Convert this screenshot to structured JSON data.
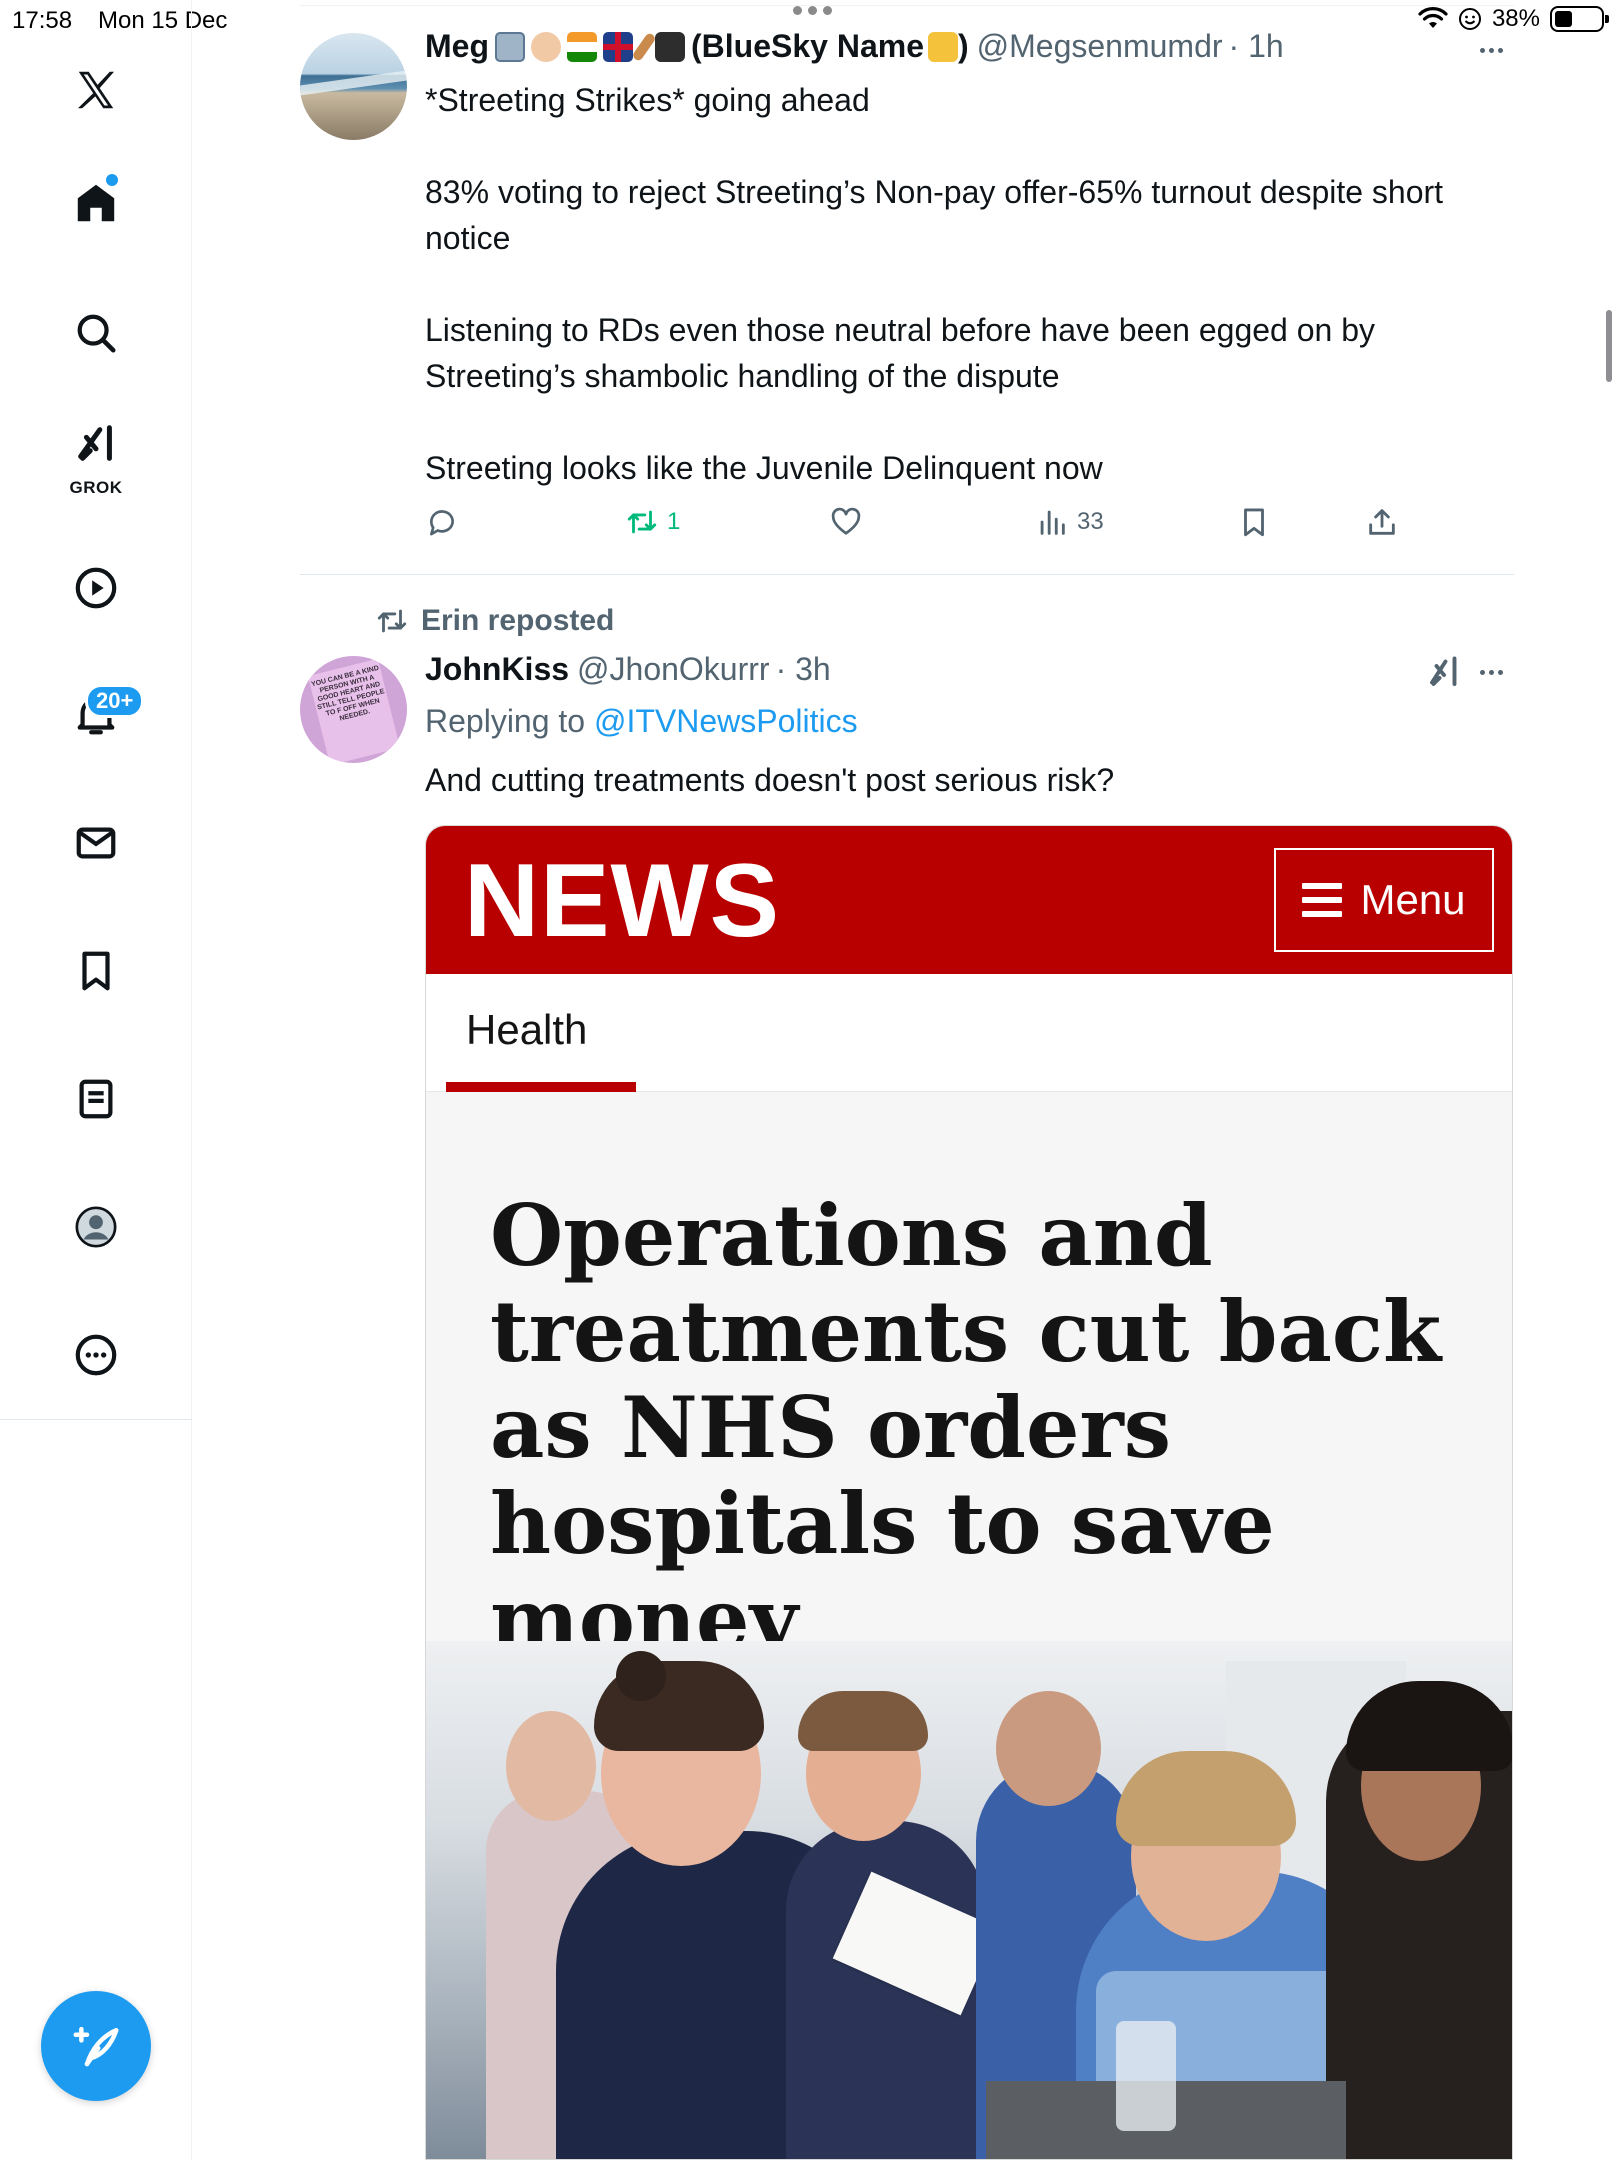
{
  "status_bar": {
    "time": "17:58",
    "date": "Mon 15 Dec",
    "battery": "38%",
    "battery_level": 0.38
  },
  "sidebar": {
    "items": [
      {
        "icon": "x-logo-icon",
        "label": "X"
      },
      {
        "icon": "home-icon",
        "label": "Home"
      },
      {
        "icon": "search-icon",
        "label": "Explore"
      },
      {
        "icon": "grok-icon",
        "label": "GROK"
      },
      {
        "icon": "video-icon",
        "label": "Videos"
      },
      {
        "icon": "bell-icon",
        "label": "Notifications"
      },
      {
        "icon": "mail-icon",
        "label": "Messages"
      },
      {
        "icon": "bookmark-icon",
        "label": "Bookmarks"
      },
      {
        "icon": "article-icon",
        "label": "Articles"
      },
      {
        "icon": "profile-icon",
        "label": "Profile"
      },
      {
        "icon": "more-icon",
        "label": "More"
      }
    ],
    "notification_badge": "20+",
    "grok_label": "GROK",
    "compose_icon": "compose-icon"
  },
  "tweets": [
    {
      "name": "Meg",
      "name_suffix": "(BlueSky Name",
      "name_close": ")",
      "handle": "@Megsenmumdr",
      "time": "· 1h",
      "text": [
        "*Streeting Strikes* going ahead",
        "83% voting to reject Streeting’s Non-pay offer-65% turnout despite short notice",
        "Listening to RDs even those neutral before have been egged on by Streeting’s shambolic handling of the dispute",
        "Streeting looks like the Juvenile Delinquent now"
      ],
      "retweets": "1",
      "views": "33"
    },
    {
      "reposted_by": "Erin reposted",
      "name": "JohnKiss",
      "handle": "@JhonOkurrr",
      "time": "· 3h",
      "replying_prefix": "Replying to",
      "replying_to": "@ITVNewsPolitics",
      "text": "And cutting treatments doesn't post serious risk?",
      "avatar_sign_text": "YOU CAN BE A KIND PERSON WITH A GOOD HEART AND STILL TELL PEOPLE TO F OFF WHEN NEEDED."
    }
  ],
  "embedded_card": {
    "logo": "NEWS",
    "menu_label": "Menu",
    "section_tab": "Health",
    "headline": "Operations and treatments cut back as NHS orders hospitals to save money",
    "brand_color": "#b80000"
  },
  "colors": {
    "accent": "#1d9bf0",
    "retweet_green": "#00ba7c",
    "secondary_text": "#536471"
  }
}
